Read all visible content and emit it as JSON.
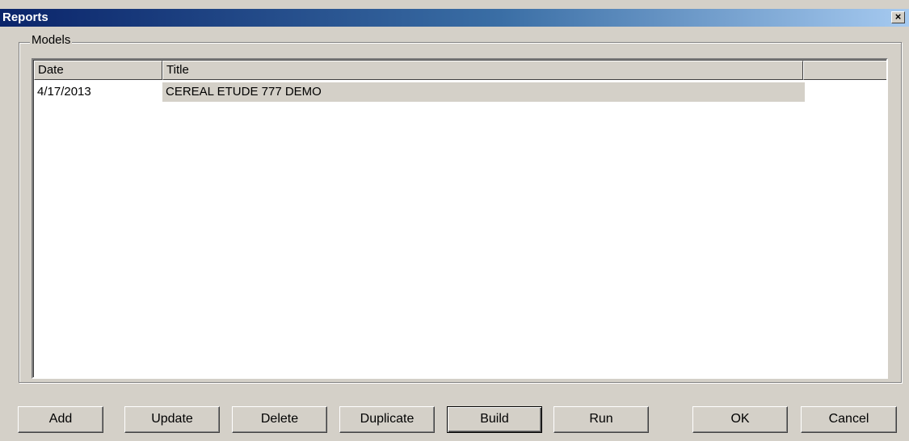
{
  "window": {
    "title": "Reports",
    "close_glyph": "×"
  },
  "group": {
    "label": "Models"
  },
  "list": {
    "columns": [
      "Date",
      "Title"
    ],
    "rows": [
      {
        "date": "4/17/2013",
        "title": "CEREAL ETUDE 777 DEMO"
      }
    ]
  },
  "buttons": {
    "add": "Add",
    "update": "Update",
    "delete": "Delete",
    "duplicate": "Duplicate",
    "build": "Build",
    "run": "Run",
    "ok": "OK",
    "cancel": "Cancel"
  },
  "colors": {
    "titlebar_start": "#0a246a",
    "titlebar_end": "#a6caf0",
    "face": "#d4d0c8"
  }
}
